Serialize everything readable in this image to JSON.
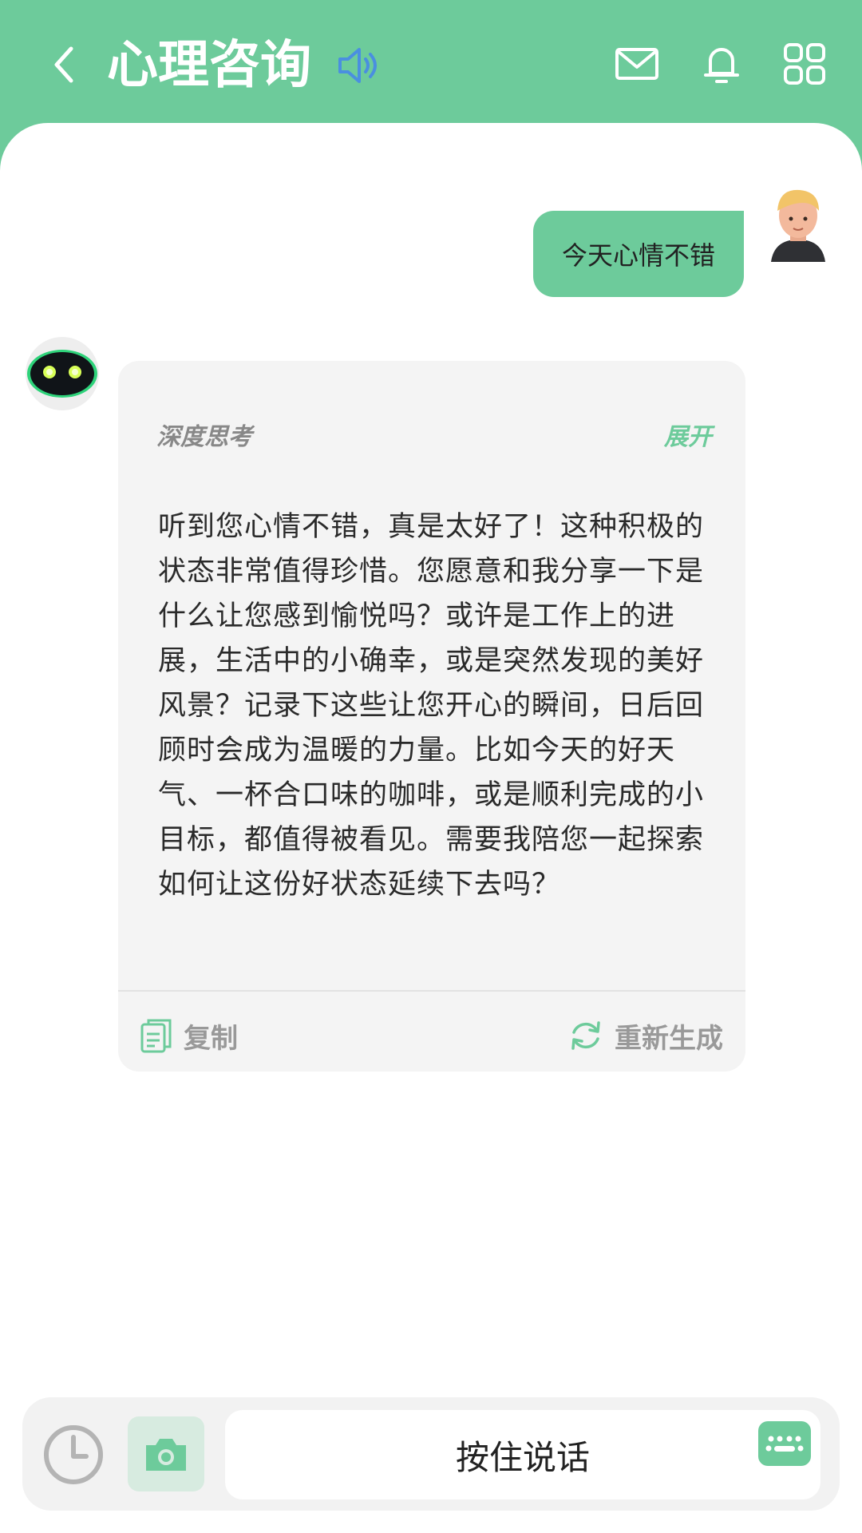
{
  "header": {
    "title": "心理咨询",
    "background_color": "#6dcb9b",
    "icons": [
      "back-icon",
      "speaker-icon",
      "mail-icon",
      "bell-icon",
      "grid-menu-icon"
    ]
  },
  "conversation": {
    "user_message": "今天心情不错",
    "bot_reply": {
      "thinking_label": "深度思考",
      "expand_label": "展开",
      "text": "听到您心情不错，真是太好了！这种积极的状态非常值得珍惜。您愿意和我分享一下是什么让您感到愉悦吗？或许是工作上的进展，生活中的小确幸，或是突然发现的美好风景？记录下这些让您开心的瞬间，日后回顾时会成为温暖的力量。比如今天的好天气、一杯合口味的咖啡，或是顺利完成的小目标，都值得被看见。需要我陪您一起探索如何让这份好状态延续下去吗？",
      "copy_label": "复制",
      "regenerate_label": "重新生成"
    }
  },
  "input_bar": {
    "hold_to_talk_label": "按住说话"
  },
  "colors": {
    "accent": "#6dcb9b",
    "speaker_icon": "#4a8fe0",
    "card_bg": "#f4f4f4"
  }
}
